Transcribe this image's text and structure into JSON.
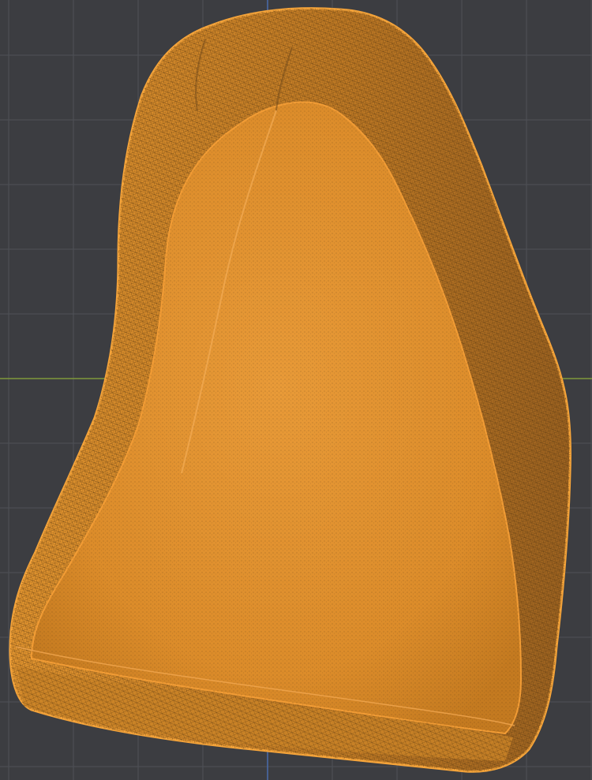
{
  "viewport": {
    "view": "3d-viewport-wireframe",
    "colors": {
      "background": "#3c3d41",
      "grid_line": "#4f5156",
      "x_axis": "#7f9a3a",
      "y_axis": "#4a6fb5",
      "mesh_selected": "#f5a030",
      "mesh_fill": "#d98a25",
      "mesh_shadow": "#8a5a1a"
    }
  }
}
